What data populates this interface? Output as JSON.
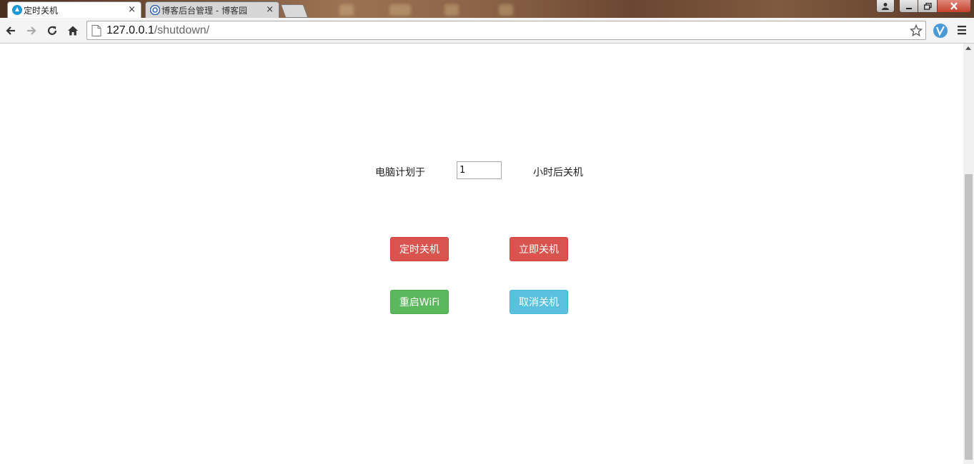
{
  "browser": {
    "tabs": [
      {
        "title": "定时关机",
        "active": true
      },
      {
        "title": "博客后台管理 - 博客园",
        "active": false
      }
    ],
    "close_glyph": "×",
    "url": {
      "host": "127.0.0.1",
      "path": "/shutdown/"
    }
  },
  "form": {
    "prefix_label": "电脑计划于",
    "hours_value": "1",
    "suffix_label": "小时后关机"
  },
  "buttons": {
    "schedule": "定时关机",
    "now": "立即关机",
    "restart_wifi": "重启WiFi",
    "cancel": "取消关机"
  },
  "colors": {
    "danger": "#d9534f",
    "success": "#5cb85c",
    "info": "#5bc0de"
  }
}
